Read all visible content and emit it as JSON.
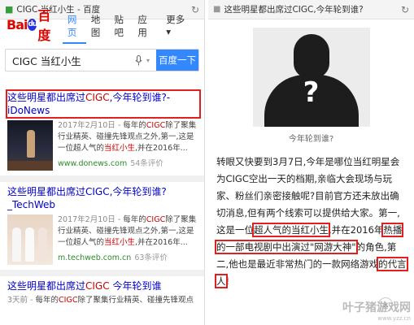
{
  "left": {
    "address_title": "CIGC 当红小生 - 百度",
    "logo": {
      "part1": "Bai",
      "part2": "百度"
    },
    "tabs": [
      "网页",
      "地图",
      "贴吧",
      "应用",
      "更多"
    ],
    "search": {
      "query": "CIGC 当红小生",
      "button": "百度一下"
    },
    "results": [
      {
        "title_pre": "这些明星都出席过",
        "title_hl": "CIGC",
        "title_post": ",今年轮到谁?-iDoNews",
        "date": "2017年2月10日 -",
        "desc_pre": " 每年的",
        "desc_hl1": "CIGC",
        "desc_mid": "除了聚集行业精英、碰撞先锋观点之外,第一,这是一位超人气的",
        "desc_hl2": "当红小生",
        "desc_post": ",并在2016年...",
        "url": "www.donews.com",
        "reviews": "54条评价"
      },
      {
        "title": "这些明星都出席过CIGC,今年轮到谁?_TechWeb",
        "date": "2017年2月10日 -",
        "desc_pre": " 每年的",
        "desc_hl1": "CIGC",
        "desc_mid": "除了聚集行业精英、碰撞先锋观点之外,第一,这是一位超人气的",
        "desc_hl2": "当红小生",
        "desc_post": ",并在2016年...",
        "url": "m.techweb.com.cn",
        "reviews": "63条评价"
      },
      {
        "title_pre": "这些明星都出席过",
        "title_hl": "CIGC",
        "title_post": " 今年轮到谁",
        "date": "3天前 -",
        "desc_pre": " 每年的",
        "desc_hl1": "CIGC",
        "desc_post": "除了聚集行业精英、碰撞先锋观点"
      }
    ]
  },
  "right": {
    "address_title": "这些明星都出席过CIGC,今年轮到谁?",
    "caption": "今年轮到谁?",
    "qmark": "?",
    "para_1": "转眼又快要到3月7日,今年是哪位当红明星会为CIGC空出一天的档期,亲临大会现场与玩家、粉丝们亲密接触呢?目前官方还未放出确切消息,但有两个线索可以提供给大家。第一,这是一位",
    "para_hl1": "超人气的当红小生",
    "para_2": ",并在2016年",
    "para_hl2": "热播的一部电视剧中出演过\"网游大神\"",
    "para_3": "的角色,第二,他也是最近非常热门的一款网络游戏",
    "para_hl3": "的代言人",
    "para_end": "!",
    "watermark": "叶子猪游戏网",
    "watermark_url": "www.yzz.cn"
  },
  "colors": {
    "accent": "#3388ff",
    "highlight_box": "#e02020",
    "link": "#0000cc",
    "url_green": "#2e8b2e"
  }
}
